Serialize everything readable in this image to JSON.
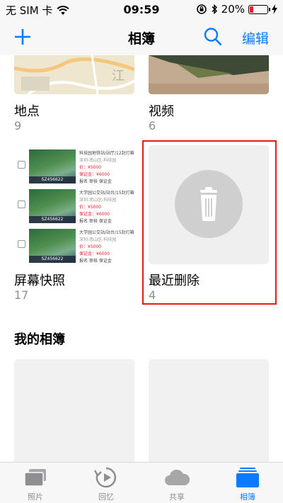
{
  "status_bar": {
    "carrier": "无 SIM 卡",
    "time": "09:59",
    "battery": "20%",
    "battery_level": 0.2
  },
  "nav": {
    "title": "相簿",
    "edit_label": "编辑"
  },
  "albums": [
    {
      "name": "地点",
      "count": "9",
      "map_text": "江"
    },
    {
      "name": "视频",
      "count": "6"
    },
    {
      "name": "屏幕快照",
      "count": "17"
    },
    {
      "name": "最近删除",
      "count": "4"
    }
  ],
  "screenshot_rows": [
    {
      "title": "科技园地铁站/站厅/12封灯箱",
      "line2": "深圳-南山区-科技园",
      "price": "价：¥5000",
      "deposit": "保证金：¥6000",
      "tags": "报名 审核 保证金",
      "code": "SZ456622"
    },
    {
      "title": "大学园公交站/站台/15封灯箱",
      "line2": "深圳-南山区-科技园",
      "price": "价：¥5000",
      "deposit": "保证金：¥6000",
      "tags": "报名 审核 保证金",
      "code": "SZ456622"
    },
    {
      "title": "大学园公交站/站台/15封灯箱",
      "line2": "深圳-南山区-科技园",
      "price": "价：¥5000",
      "deposit": "保证金：¥6000",
      "tags": "报名 审核 保证金",
      "code": "SZ456622"
    }
  ],
  "my_albums": {
    "title": "我的相簿"
  },
  "tab_bar": {
    "tabs": [
      {
        "label": "照片",
        "icon": "photos-icon"
      },
      {
        "label": "回忆",
        "icon": "memories-icon"
      },
      {
        "label": "共享",
        "icon": "cloud-icon"
      },
      {
        "label": "相簿",
        "icon": "albums-icon"
      }
    ],
    "active_index": 3
  },
  "colors": {
    "accent": "#0a7aff",
    "highlight": "#e31c1c",
    "battery_low": "#e0262c"
  }
}
